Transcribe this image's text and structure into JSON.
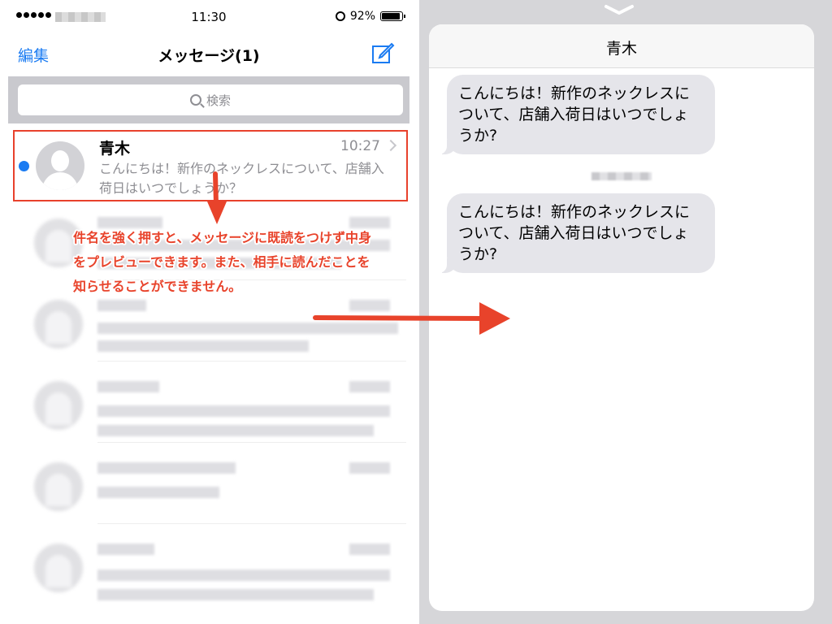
{
  "status_bar": {
    "time": "11:30",
    "battery": "92%"
  },
  "nav": {
    "edit_label": "編集",
    "title": "メッセージ(1)"
  },
  "search": {
    "placeholder": "検索"
  },
  "message": {
    "sender": "青木",
    "time": "10:27",
    "preview": "こんにちは！新作のネックレスについて、店舗入荷日はいつでしょうか？"
  },
  "annotation": {
    "text": "件名を強く押すと、メッセージに既読をつけず中身をプレビューできます。また、相手に読んだことを知らせることができません。"
  },
  "preview": {
    "title": "青木",
    "bubbles": [
      "こんにちは！新作のネックレスについて、店舗入荷日はいつでしょうか?",
      "こんにちは！新作のネックレスについて、店舗入荷日はいつでしょうか?"
    ]
  },
  "colors": {
    "accent": "#1a7bf2",
    "annotation": "#e8432b",
    "highlight_border": "#e8412c",
    "bubble": "#e5e5ea"
  }
}
